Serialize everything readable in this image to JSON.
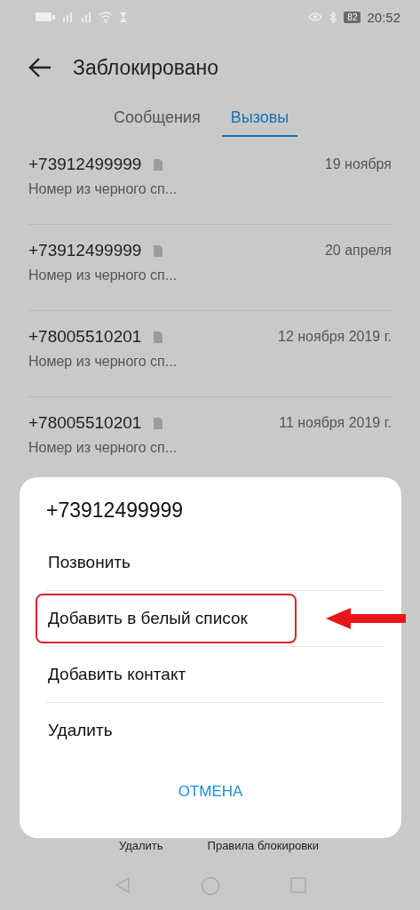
{
  "status_bar": {
    "time": "20:52",
    "battery": "82"
  },
  "header": {
    "title": "Заблокировано"
  },
  "tabs": [
    {
      "label": "Сообщения",
      "selected": false
    },
    {
      "label": "Вызовы",
      "selected": true
    }
  ],
  "calls": [
    {
      "number": "+73912499999",
      "date": "19 ноября",
      "note": "Номер из черного сп..."
    },
    {
      "number": "+73912499999",
      "date": "20 апреля",
      "note": "Номер из черного сп..."
    },
    {
      "number": "+78005510201",
      "date": "12 ноября 2019 г.",
      "note": "Номер из черного сп..."
    },
    {
      "number": "+78005510201",
      "date": "11 ноября 2019 г.",
      "note": "Номер из черного сп..."
    }
  ],
  "bottom_actions": [
    "Удалить",
    "Правила блокировки"
  ],
  "dialog": {
    "title": "+73912499999",
    "options": [
      {
        "label": "Позвонить",
        "highlighted": false
      },
      {
        "label": "Добавить в белый список",
        "highlighted": true
      },
      {
        "label": "Добавить контакт",
        "highlighted": false
      },
      {
        "label": "Удалить",
        "highlighted": false
      }
    ],
    "cancel": "ОТМЕНА"
  }
}
